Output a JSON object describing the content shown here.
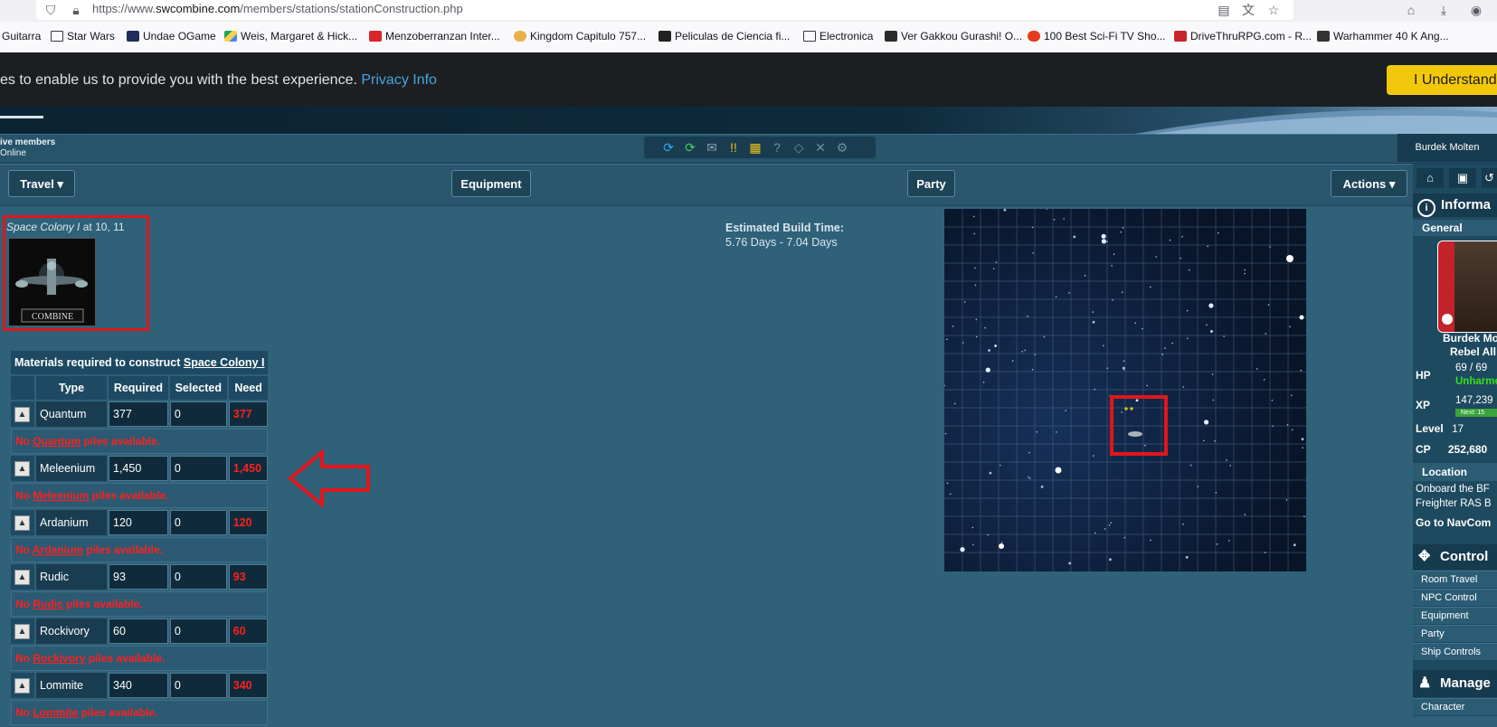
{
  "browser": {
    "url_prefix": "https://www.",
    "url_domain": "swcombine.com",
    "url_path": "/members/stations/stationConstruction.php",
    "bookmarks": [
      {
        "label": "Guitarra",
        "icon": "folder-icon"
      },
      {
        "label": "Star Wars",
        "icon": "folder-icon"
      },
      {
        "label": "Undae OGame",
        "icon": "site-icon"
      },
      {
        "label": "Weis, Margaret & Hick...",
        "icon": "drive-icon"
      },
      {
        "label": "Menzoberranzan Inter...",
        "icon": "site-icon"
      },
      {
        "label": "Kingdom Capitulo 757...",
        "icon": "site-icon"
      },
      {
        "label": "Peliculas de Ciencia fi...",
        "icon": "site-icon"
      },
      {
        "label": "Electronica",
        "icon": "folder-icon"
      },
      {
        "label": "Ver Gakkou Gurashi! O...",
        "icon": "site-icon"
      },
      {
        "label": "100 Best Sci-Fi TV Sho...",
        "icon": "tomato-icon"
      },
      {
        "label": "DriveThruRPG.com - R...",
        "icon": "site-icon"
      },
      {
        "label": "Warhammer 40 K Ang...",
        "icon": "site-icon"
      }
    ]
  },
  "cookie": {
    "text": "es to enable us to provide you with the best experience. ",
    "link": "Privacy Info",
    "button": "I Understand"
  },
  "header": {
    "online_line1": "ive members",
    "online_line2": "Online",
    "user": "Burdek Molten"
  },
  "nav": {
    "travel": "Travel ▾",
    "equipment": "Equipment",
    "party": "Party",
    "actions": "Actions ▾"
  },
  "station": {
    "name": "Space Colony I",
    "location": " at 10, 11",
    "image_caption": "COMBINE"
  },
  "build": {
    "label": "Estimated Build Time:",
    "value": "5.76 Days - 7.04 Days"
  },
  "materials": {
    "heading_prefix": "Materials required to construct ",
    "heading_link": "Space Colony I",
    "columns": [
      "Type",
      "Required",
      "Selected",
      "Need"
    ],
    "rows": [
      {
        "type": "Quantum",
        "required": "377",
        "selected": "0",
        "need": "377"
      },
      {
        "type": "Meleenium",
        "required": "1,450",
        "selected": "0",
        "need": "1,450"
      },
      {
        "type": "Ardanium",
        "required": "120",
        "selected": "0",
        "need": "120"
      },
      {
        "type": "Rudic",
        "required": "93",
        "selected": "0",
        "need": "93"
      },
      {
        "type": "Rockivory",
        "required": "60",
        "selected": "0",
        "need": "60"
      },
      {
        "type": "Lommite",
        "required": "340",
        "selected": "0",
        "need": "340"
      }
    ],
    "no_prefix": "No ",
    "no_suffix": " piles available."
  },
  "sidebar": {
    "info_title": "Informa",
    "general": "General",
    "name": "Burdek Mo",
    "faction": "Rebel All",
    "hp_label": "HP",
    "hp_value": "69 / 69",
    "hp_status": "Unharme",
    "xp_label": "XP",
    "xp_value": "147,239",
    "xp_next": "Next: 15",
    "level_label": "Level",
    "level_value": "17",
    "cp_label": "CP",
    "cp_value": "252,680",
    "location_label": "Location",
    "location_line1": "Onboard the BF",
    "location_line2": "Freighter RAS B",
    "navcomp": "Go to NavCom",
    "control_title": "Control",
    "controls": [
      "Room Travel",
      "NPC Control",
      "Equipment",
      "Party",
      "Ship Controls"
    ],
    "manage_title": "Manage",
    "manage_item": "Character"
  },
  "colors": {
    "page_bg": "#2f6179",
    "need_red": "#ff1f1f",
    "highlight_red": "#e0161c",
    "cookie_button": "#f2c80b"
  }
}
